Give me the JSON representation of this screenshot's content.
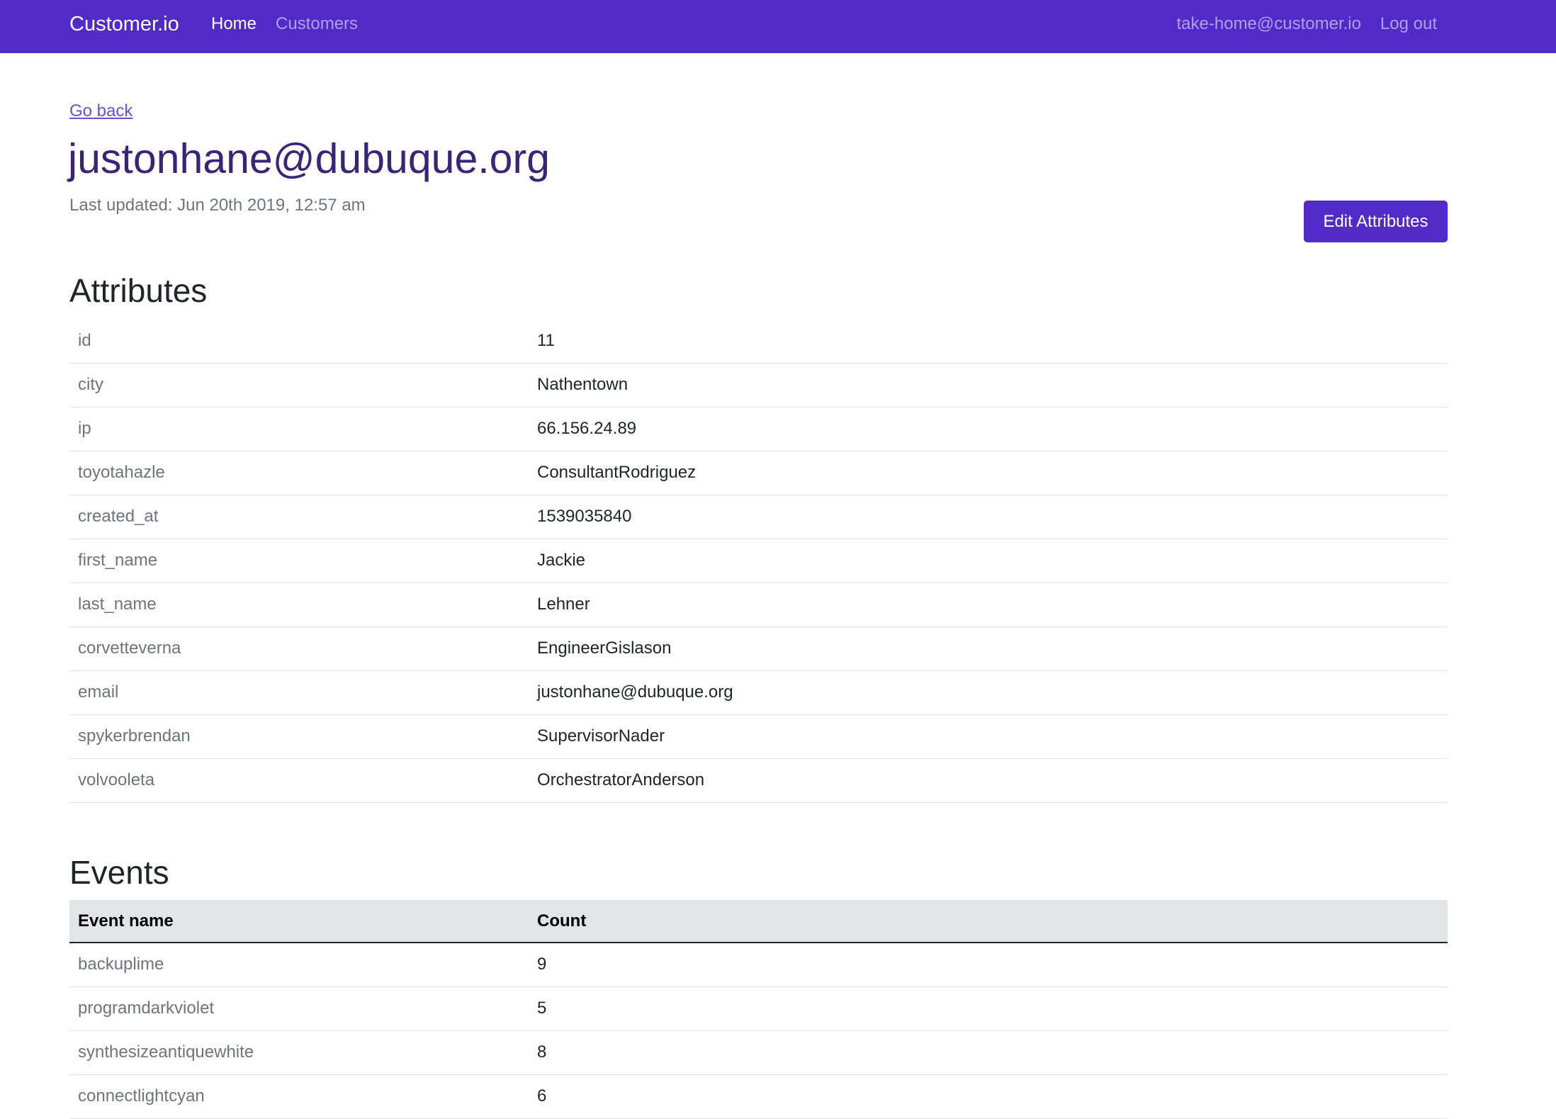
{
  "navbar": {
    "brand": "Customer.io",
    "home": "Home",
    "customers": "Customers",
    "user_email": "take-home@customer.io",
    "logout": "Log out",
    "color": "#512bc8"
  },
  "page": {
    "go_back": "Go back",
    "title": "justonhane@dubuque.org",
    "last_updated": "Last updated: Jun 20th 2019, 12:57 am",
    "edit_button": "Edit Attributes"
  },
  "attributes": {
    "heading": "Attributes",
    "rows": [
      {
        "key": "id",
        "value": "11"
      },
      {
        "key": "city",
        "value": "Nathentown"
      },
      {
        "key": "ip",
        "value": "66.156.24.89"
      },
      {
        "key": "toyotahazle",
        "value": "ConsultantRodriguez"
      },
      {
        "key": "created_at",
        "value": "1539035840"
      },
      {
        "key": "first_name",
        "value": "Jackie"
      },
      {
        "key": "last_name",
        "value": "Lehner"
      },
      {
        "key": "corvetteverna",
        "value": "EngineerGislason"
      },
      {
        "key": "email",
        "value": "justonhane@dubuque.org"
      },
      {
        "key": "spykerbrendan",
        "value": "SupervisorNader"
      },
      {
        "key": "volvooleta",
        "value": "OrchestratorAnderson"
      }
    ]
  },
  "events": {
    "heading": "Events",
    "columns": [
      "Event name",
      "Count"
    ],
    "rows": [
      {
        "name": "backuplime",
        "count": "9"
      },
      {
        "name": "programdarkviolet",
        "count": "5"
      },
      {
        "name": "synthesizeantiquewhite",
        "count": "8"
      },
      {
        "name": "connectlightcyan",
        "count": "6"
      }
    ]
  }
}
